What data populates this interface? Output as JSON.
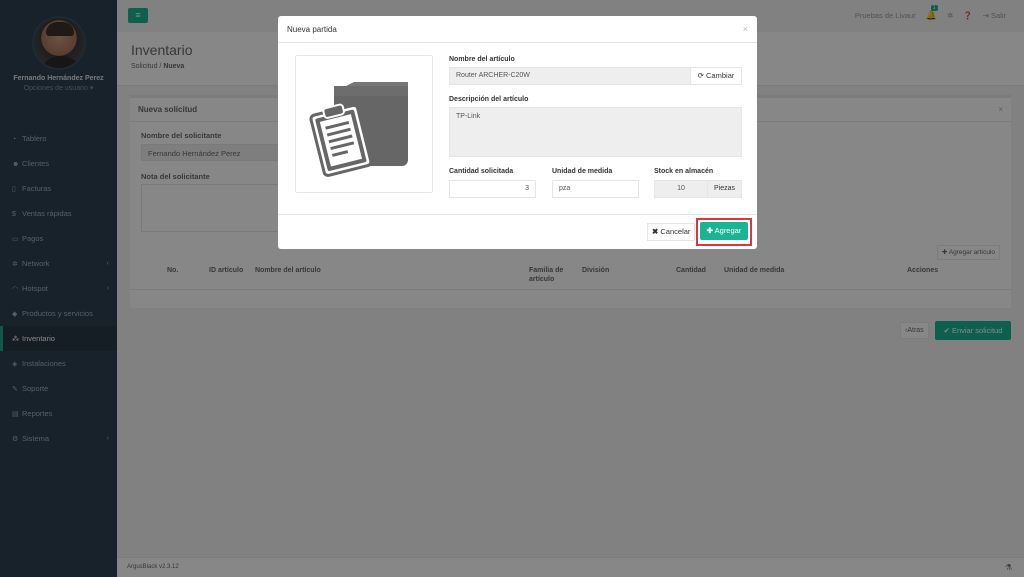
{
  "sidebar": {
    "user_name": "Fernando Hernández Perez",
    "user_options": "Opciones de usuario",
    "items": [
      {
        "label": "Tablero",
        "icon": "dashboard-icon",
        "glyph": "◔"
      },
      {
        "label": "Clientes",
        "icon": "users-icon",
        "glyph": "☻"
      },
      {
        "label": "Facturas",
        "icon": "file-icon",
        "glyph": "▯"
      },
      {
        "label": "Ventas rápidas",
        "icon": "dollar-icon",
        "glyph": "$"
      },
      {
        "label": "Pagos",
        "icon": "money-icon",
        "glyph": "▭"
      },
      {
        "label": "Network",
        "icon": "network-icon",
        "glyph": "✲"
      },
      {
        "label": "Hotspot",
        "icon": "wifi-icon",
        "glyph": "◠"
      },
      {
        "label": "Productos y servicios",
        "icon": "tag-icon",
        "glyph": "◆"
      },
      {
        "label": "Inventario",
        "icon": "cubes-icon",
        "glyph": "⁂"
      },
      {
        "label": "Instalaciones",
        "icon": "wrench-icon",
        "glyph": "◈"
      },
      {
        "label": "Soporte",
        "icon": "tools-icon",
        "glyph": "✎"
      },
      {
        "label": "Reportes",
        "icon": "book-icon",
        "glyph": "▤"
      },
      {
        "label": "Sistema",
        "icon": "cogs-icon",
        "glyph": "⚙"
      }
    ]
  },
  "topbar": {
    "account": "Pruebas de Livaur",
    "notification_count": "1",
    "logout": "Salir"
  },
  "heading": {
    "title": "Inventario",
    "breadcrumb_parent": "Solicitud",
    "breadcrumb_current": "Nueva"
  },
  "panel": {
    "title": "Nueva solicitud",
    "requester_label": "Nombre del solicitante",
    "requester_value": "Fernando Hernández Perez",
    "note_label": "Nota del solicitante",
    "add_item_label": "Agregar artículo",
    "table_headers": [
      "No.",
      "ID artículo",
      "Nombre del artículo",
      "Familia de artículo",
      "División",
      "Cantidad",
      "Unidad de medida",
      "Acciones"
    ]
  },
  "actions": {
    "back_label": "Atras",
    "send_label": "Enviar solicitud"
  },
  "footer": {
    "version": "ArgusBlack v2.3.12"
  },
  "modal": {
    "title": "Nueva partida",
    "item_name_label": "Nombre del artículo",
    "item_name_value": "Router ARCHER-C20W",
    "change_label": "Cambiar",
    "description_label": "Descripción del artículo",
    "description_value": "TP-Link",
    "qty_label": "Cantidad solicitada",
    "qty_value": "3",
    "unit_label": "Unidad de medida",
    "unit_value": "pza",
    "stock_label": "Stock en almacén",
    "stock_value": "10",
    "stock_unit": "Piezas",
    "cancel_label": "Cancelar",
    "add_label": "Agregar"
  },
  "colors": {
    "accent": "#1ab394",
    "sidebar": "#2f4050",
    "highlight": "#d9363e"
  }
}
